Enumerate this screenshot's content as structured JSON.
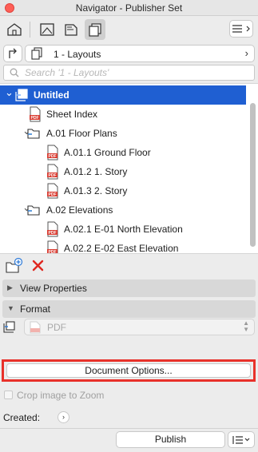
{
  "window": {
    "title": "Navigator - Publisher Set"
  },
  "toolbar": {
    "views": [
      {
        "icon": "project-map-icon",
        "selected": false
      },
      {
        "icon": "view-map-icon",
        "selected": false
      },
      {
        "icon": "layout-book-icon",
        "selected": false
      },
      {
        "icon": "publisher-sets-icon",
        "selected": true
      }
    ],
    "menu_icon": "hamburger-menu-icon"
  },
  "set_selector": {
    "value": "1 - Layouts"
  },
  "search": {
    "placeholder": "Search '1 - Layouts'",
    "value": ""
  },
  "tree": {
    "items": [
      {
        "label": "Untitled",
        "icon": "publisher-set-icon",
        "depth": 0,
        "disclosure": "open",
        "selected": true
      },
      {
        "label": "Sheet Index",
        "icon": "pdf-file-icon",
        "depth": 1,
        "disclosure": "none",
        "selected": false
      },
      {
        "label": "A.01 Floor Plans",
        "icon": "folder-icon",
        "depth": 1,
        "disclosure": "open",
        "selected": false
      },
      {
        "label": "A.01.1 Ground Floor",
        "icon": "pdf-file-icon",
        "depth": 2,
        "disclosure": "none",
        "selected": false
      },
      {
        "label": "A.01.2 1. Story",
        "icon": "pdf-file-icon",
        "depth": 2,
        "disclosure": "none",
        "selected": false
      },
      {
        "label": "A.01.3 2. Story",
        "icon": "pdf-file-icon",
        "depth": 2,
        "disclosure": "none",
        "selected": false
      },
      {
        "label": "A.02 Elevations",
        "icon": "folder-icon",
        "depth": 1,
        "disclosure": "open",
        "selected": false
      },
      {
        "label": "A.02.1 E-01 North Elevation",
        "icon": "pdf-file-icon",
        "depth": 2,
        "disclosure": "none",
        "selected": false
      },
      {
        "label": "A.02.2 E-02 East Elevation",
        "icon": "pdf-file-icon",
        "depth": 2,
        "disclosure": "none",
        "selected": false
      }
    ]
  },
  "panels": {
    "view_properties": {
      "label": "View Properties",
      "expanded": false
    },
    "format": {
      "label": "Format",
      "expanded": true,
      "value": "PDF"
    }
  },
  "document_options": {
    "label": "Document Options..."
  },
  "crop": {
    "label": "Crop image to Zoom",
    "checked": false
  },
  "created": {
    "label": "Created:"
  },
  "publish": {
    "label": "Publish"
  },
  "colors": {
    "selection": "#1f5fd2",
    "highlight_frame": "#e8312a",
    "delete_icon": "#e0271f",
    "pdf_red": "#d93a2f",
    "folder_blue": "#3b86d6"
  }
}
